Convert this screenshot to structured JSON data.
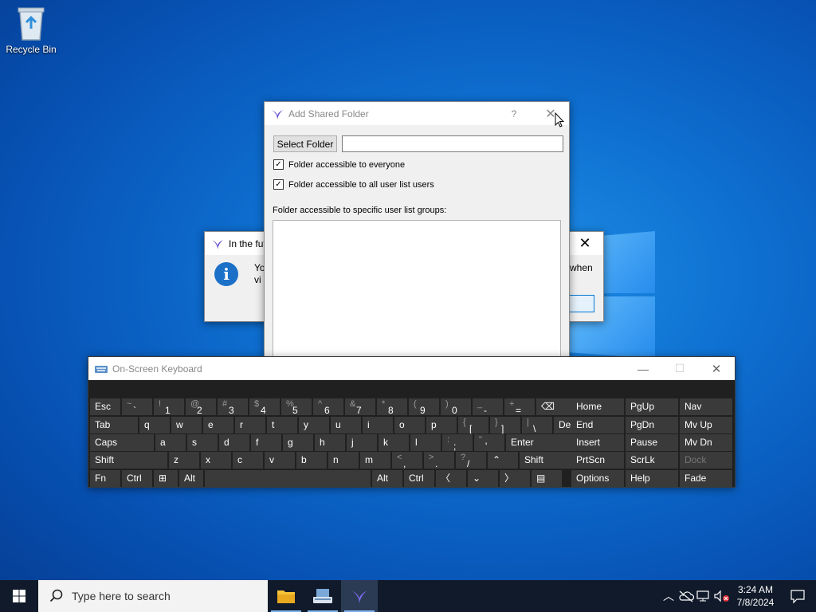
{
  "desktop": {
    "recycle_bin_label": "Recycle Bin"
  },
  "message_window": {
    "title": "In the futu",
    "text_left_1": "Yo",
    "text_left_2": "vi",
    "text_right": "when"
  },
  "dialog": {
    "title": "Add Shared Folder",
    "help_label": "?",
    "select_folder_label": "Select Folder",
    "folder_path_value": "",
    "chk_everyone_label": "Folder accessible to everyone",
    "chk_everyone_checked": "✓",
    "chk_all_users_label": "Folder accessible to all user list users",
    "chk_all_users_checked": "✓",
    "groups_label": "Folder accessible to specific user list groups:"
  },
  "osk": {
    "title": "On-Screen Keyboard",
    "rows": [
      [
        {
          "t": "Esc"
        },
        {
          "u": "~",
          "l": "`"
        },
        {
          "u": "!",
          "l": "1"
        },
        {
          "u": "@",
          "l": "2"
        },
        {
          "u": "#",
          "l": "3"
        },
        {
          "u": "$",
          "l": "4"
        },
        {
          "u": "%",
          "l": "5"
        },
        {
          "u": "^",
          "l": "6"
        },
        {
          "u": "&",
          "l": "7"
        },
        {
          "u": "*",
          "l": "8"
        },
        {
          "u": "(",
          "l": "9"
        },
        {
          "u": ")",
          "l": "0"
        },
        {
          "u": "_",
          "l": "-"
        },
        {
          "u": "+",
          "l": "="
        },
        {
          "t": "⌫"
        }
      ],
      [
        {
          "t": "Tab"
        },
        {
          "t": "q"
        },
        {
          "t": "w"
        },
        {
          "t": "e"
        },
        {
          "t": "r"
        },
        {
          "t": "t"
        },
        {
          "t": "y"
        },
        {
          "t": "u"
        },
        {
          "t": "i"
        },
        {
          "t": "o"
        },
        {
          "t": "p"
        },
        {
          "u": "{",
          "l": "["
        },
        {
          "u": "}",
          "l": "]"
        },
        {
          "u": "|",
          "l": "\\"
        },
        {
          "t": "Del"
        }
      ],
      [
        {
          "t": "Caps"
        },
        {
          "t": "a"
        },
        {
          "t": "s"
        },
        {
          "t": "d"
        },
        {
          "t": "f"
        },
        {
          "t": "g"
        },
        {
          "t": "h"
        },
        {
          "t": "j"
        },
        {
          "t": "k"
        },
        {
          "t": "l"
        },
        {
          "u": ":",
          "l": ";"
        },
        {
          "u": "\"",
          "l": "'"
        },
        {
          "t": "Enter"
        }
      ],
      [
        {
          "t": "Shift"
        },
        {
          "t": "z"
        },
        {
          "t": "x"
        },
        {
          "t": "c"
        },
        {
          "t": "v"
        },
        {
          "t": "b"
        },
        {
          "t": "n"
        },
        {
          "t": "m"
        },
        {
          "u": "<",
          "l": ","
        },
        {
          "u": ">",
          "l": "."
        },
        {
          "u": "?",
          "l": "/"
        },
        {
          "t": "⌃"
        },
        {
          "t": "Shift"
        }
      ],
      [
        {
          "t": "Fn"
        },
        {
          "t": "Ctrl"
        },
        {
          "t": "⊞"
        },
        {
          "t": "Alt"
        },
        {
          "t": ""
        },
        {
          "t": "Alt"
        },
        {
          "t": "Ctrl"
        },
        {
          "t": "〈"
        },
        {
          "t": "⌄"
        },
        {
          "t": "〉"
        },
        {
          "t": "▤"
        }
      ]
    ],
    "nav": [
      [
        "Home",
        "PgUp",
        "Nav"
      ],
      [
        "End",
        "PgDn",
        "Mv Up"
      ],
      [
        "Insert",
        "Pause",
        "Mv Dn"
      ],
      [
        "PrtScn",
        "ScrLk",
        "Dock"
      ],
      [
        "Options",
        "Help",
        "Fade"
      ]
    ]
  },
  "taskbar": {
    "search_placeholder": "Type here to search",
    "time": "3:24 AM",
    "date": "7/8/2024"
  }
}
